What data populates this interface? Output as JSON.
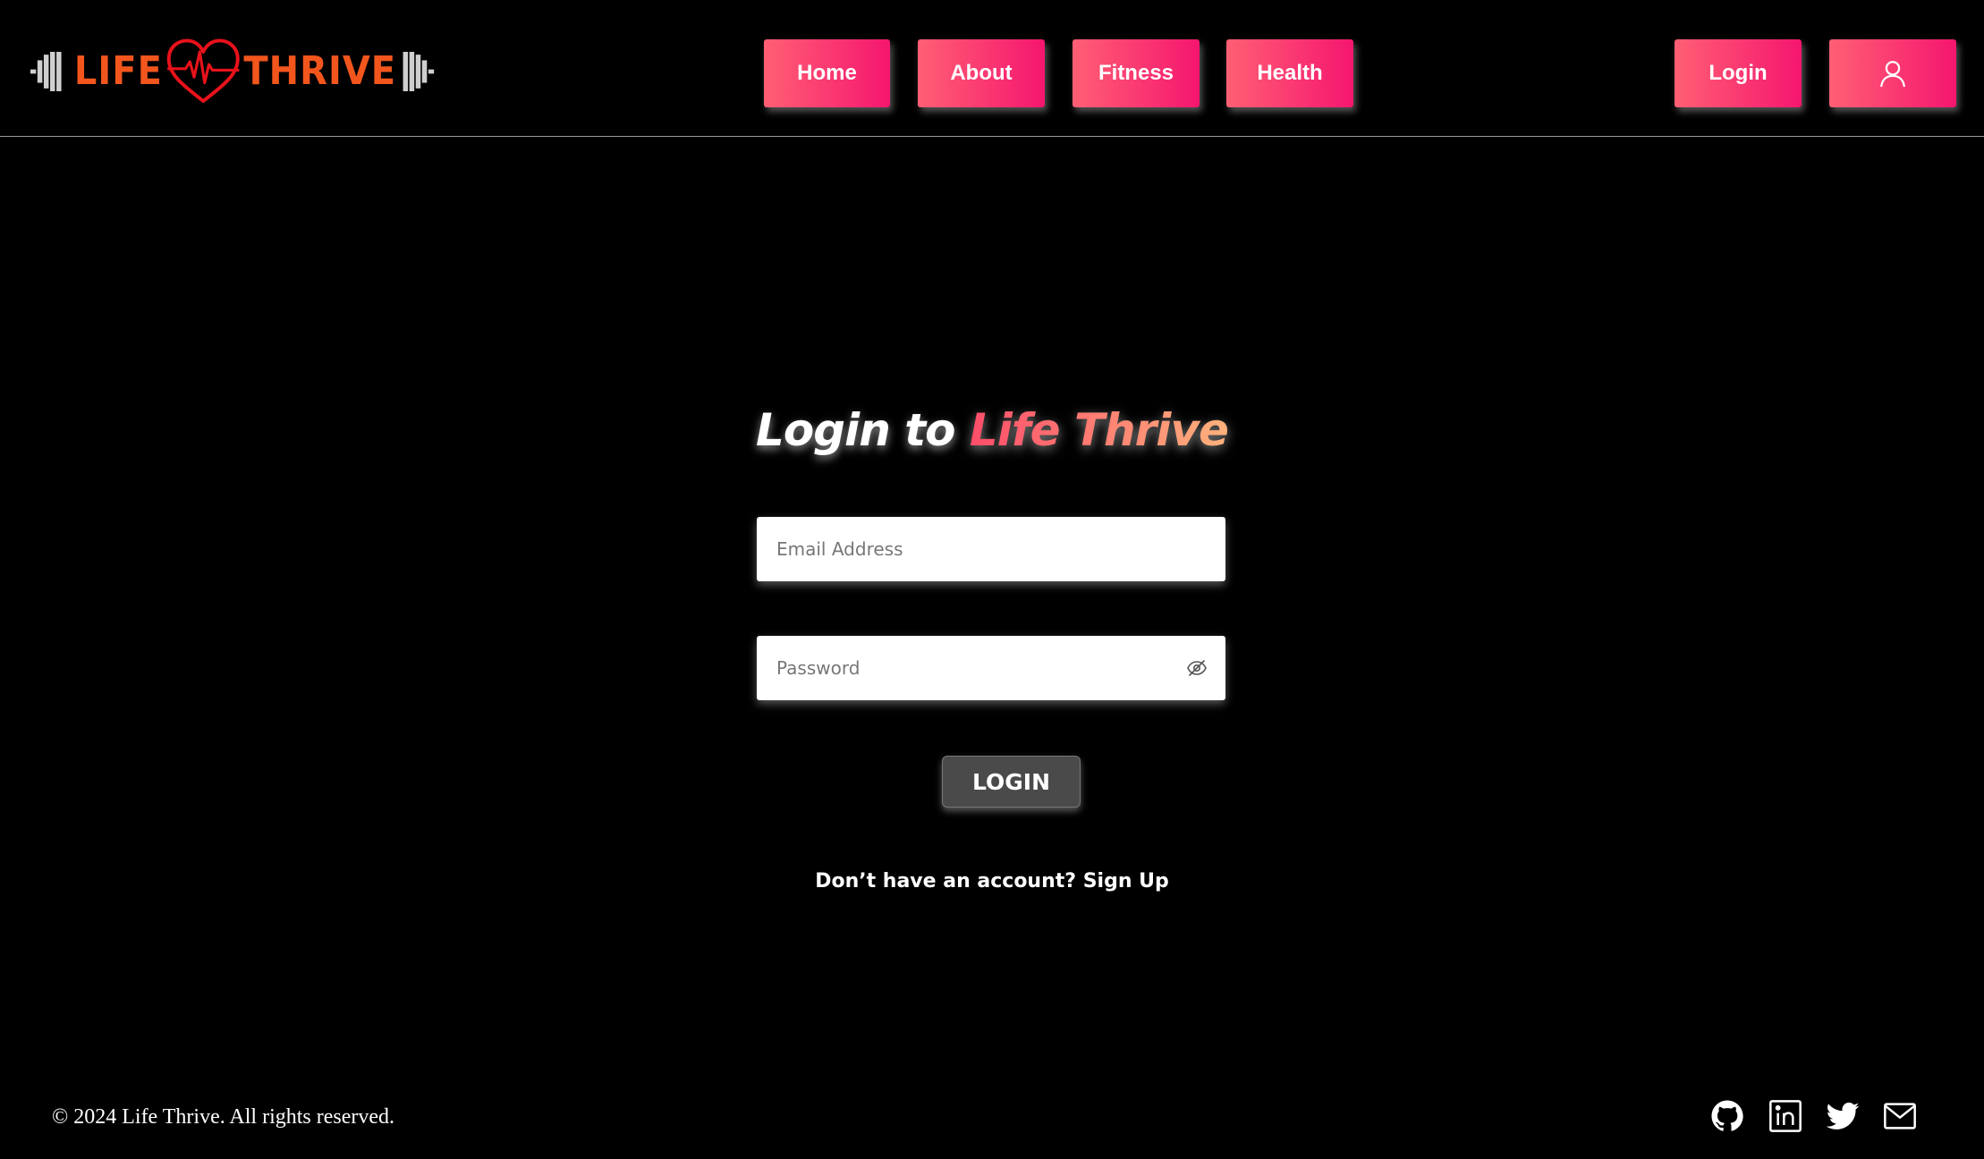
{
  "header": {
    "logo": {
      "left_word": "LIFE",
      "right_word": "THRIVE"
    },
    "nav": [
      {
        "label": "Home"
      },
      {
        "label": "About"
      },
      {
        "label": "Fitness"
      },
      {
        "label": "Health"
      }
    ],
    "login_label": "Login",
    "profile_icon": "user-icon"
  },
  "login_form": {
    "title_prefix": "Login to",
    "title_brand": "Life Thrive",
    "email": {
      "placeholder": "Email Address",
      "value": ""
    },
    "password": {
      "placeholder": "Password",
      "value": "",
      "toggle_icon": "eye-slash-icon"
    },
    "submit_label": "LOGIN",
    "signup_prompt": "Don’t have an account?",
    "signup_link": "Sign Up"
  },
  "footer": {
    "copyright": "© 2024 Life Thrive. All rights reserved.",
    "social_icons": [
      "github-icon",
      "linkedin-icon",
      "twitter-icon",
      "mail-icon"
    ]
  },
  "colors": {
    "background": "#000000",
    "button_gradient_start": "#ff5f74",
    "button_gradient_end": "#f5166f",
    "logo_text": "#f2561d",
    "heart": "#e8121b",
    "login_button": "#4a4a4a"
  }
}
